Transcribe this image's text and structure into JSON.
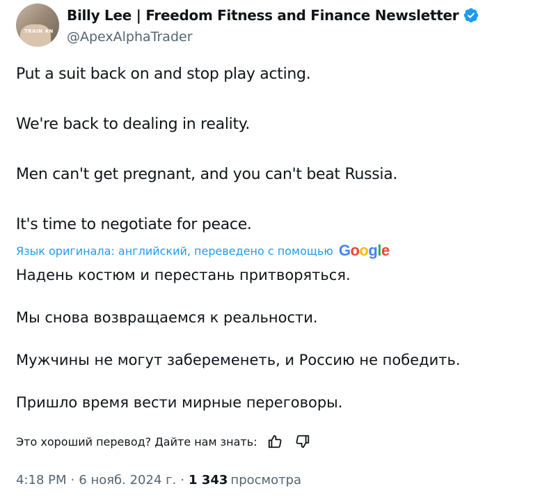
{
  "author": {
    "display_name": "Billy Lee | Freedom Fitness and Finance Newsletter",
    "handle": "@ApexAlphaTrader",
    "avatar_text": "TRAIN AN",
    "verified_color": "#1d9bf0"
  },
  "tweet": {
    "paragraphs": [
      "Put a suit back on and stop play acting.",
      "We're back to dealing in reality.",
      "Men can't get pregnant, and you can't beat Russia.",
      "It's time to negotiate for peace."
    ]
  },
  "translation": {
    "notice": "Язык оригинала: английский, переведено с помощью",
    "provider_letters": [
      "G",
      "o",
      "o",
      "g",
      "l",
      "e"
    ],
    "paragraphs": [
      "Надень костюм и перестань притворяться.",
      "Мы снова возвращаемся к реальности.",
      "Мужчины не могут забеременеть, и Россию не победить.",
      "Пришло время вести мирные переговоры."
    ],
    "feedback_prompt": "Это хороший перевод? Дайте нам знать:",
    "thumbs_up_icon": "thumbs-up-icon",
    "thumbs_down_icon": "thumbs-down-icon"
  },
  "meta": {
    "time": "4:18 PM",
    "separator": "·",
    "date": "6 нояб. 2024 г.",
    "views_count": "1 343",
    "views_label": "просмотра"
  },
  "colors": {
    "text": "#0f1419",
    "secondary": "#536471",
    "link": "#1d9bf0"
  }
}
